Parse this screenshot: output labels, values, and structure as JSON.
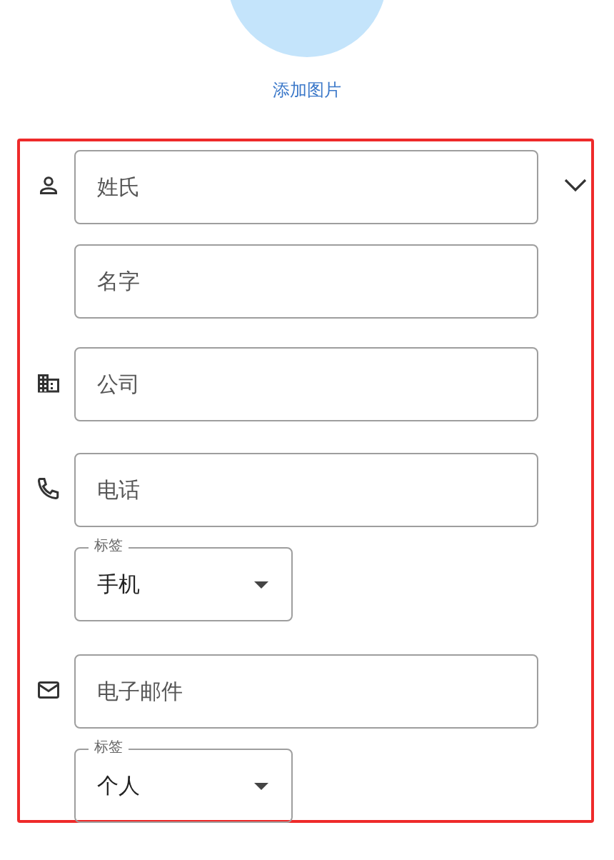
{
  "add_photo": {
    "label": "添加图片"
  },
  "form": {
    "expand_toggle": true,
    "groups": [
      {
        "kind": "person",
        "fields": [
          {
            "kind": "text",
            "placeholder": "姓氏"
          },
          {
            "kind": "text",
            "placeholder": "名字"
          }
        ]
      },
      {
        "kind": "company",
        "fields": [
          {
            "kind": "text",
            "placeholder": "公司"
          }
        ]
      },
      {
        "kind": "phone",
        "fields": [
          {
            "kind": "text",
            "placeholder": "电话"
          },
          {
            "kind": "select",
            "label": "标签",
            "value": "手机"
          }
        ]
      },
      {
        "kind": "email",
        "fields": [
          {
            "kind": "text",
            "placeholder": "电子邮件"
          },
          {
            "kind": "select",
            "label": "标签",
            "value": "个人"
          }
        ]
      }
    ]
  }
}
